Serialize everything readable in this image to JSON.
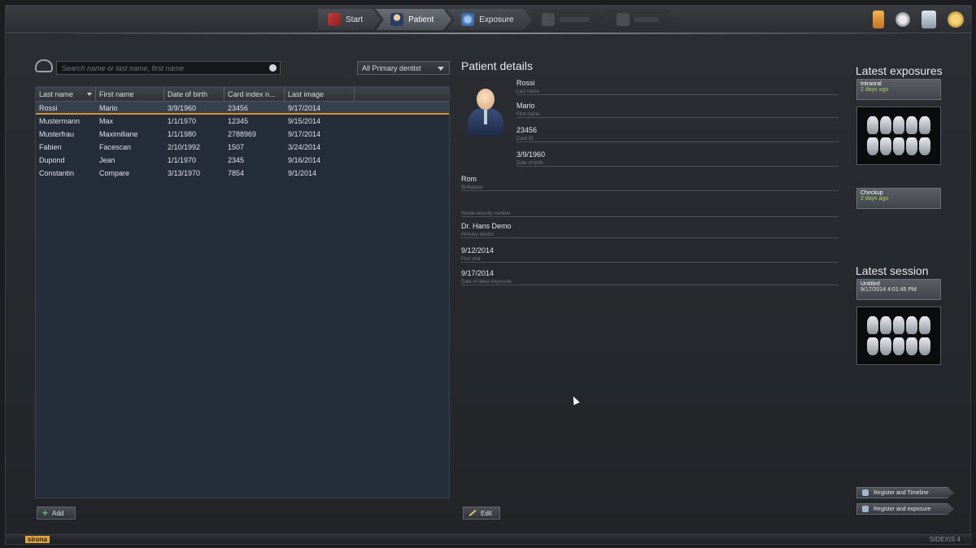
{
  "nav": {
    "steps": [
      {
        "label": "Start",
        "icon": "start-icon",
        "state": "normal"
      },
      {
        "label": "Patient",
        "icon": "patient-icon",
        "state": "active"
      },
      {
        "label": "Exposure",
        "icon": "exposure-icon",
        "state": "normal"
      },
      {
        "label": "",
        "icon": "disabled-step-icon",
        "state": "disabled"
      },
      {
        "label": "",
        "icon": "disabled-step-icon",
        "state": "disabled"
      }
    ],
    "tools": [
      "folder-icon",
      "gear-icon",
      "monitor-icon",
      "help-icon"
    ]
  },
  "search": {
    "placeholder": "Search name or last name, first name",
    "dentist_filter": "All Primary dentist"
  },
  "patient_table": {
    "columns": [
      "Last name",
      "First name",
      "Date of birth",
      "Card index n...",
      "Last image"
    ],
    "rows": [
      [
        "Rossi",
        "Mario",
        "3/9/1960",
        "23456",
        "9/17/2014"
      ],
      [
        "Mustermann",
        "Max",
        "1/1/1970",
        "12345",
        "9/15/2014"
      ],
      [
        "Musterfrau",
        "Maximiliane",
        "1/1/1980",
        "2788969",
        "9/17/2014"
      ],
      [
        "Fabien",
        "Facescan",
        "2/10/1992",
        "1507",
        "3/24/2014"
      ],
      [
        "Dupond",
        "Jean",
        "1/1/1970",
        "2345",
        "9/16/2014"
      ],
      [
        "Constantin",
        "Compare",
        "3/13/1970",
        "7854",
        "9/1/2014"
      ]
    ],
    "selected_row": 0
  },
  "buttons": {
    "add": "Add",
    "edit": "Edit",
    "register_timeline": "Register and Timeline",
    "register_exposure": "Register and exposure"
  },
  "patient_details": {
    "title": "Patient details",
    "fields": [
      {
        "value": "Rossi",
        "label": "Last name"
      },
      {
        "value": "Mario",
        "label": "First name"
      },
      {
        "value": "23456",
        "label": "Card ID"
      },
      {
        "value": "3/9/1960",
        "label": "Date of birth"
      },
      {
        "value": "Rom",
        "label": "Birthplace"
      },
      {
        "value": "",
        "label": "Social security number"
      },
      {
        "value": "Dr. Hans Demo",
        "label": "Primary dentist"
      },
      {
        "value": "9/12/2014",
        "label": "First visit"
      },
      {
        "value": "9/17/2014",
        "label": "Date of latest exposure"
      }
    ]
  },
  "latest_exposures": {
    "title": "Latest exposures",
    "items": [
      {
        "name": "Intraoral",
        "when": "2 days ago"
      },
      {
        "name": "Checkup",
        "when": "2 days ago"
      }
    ]
  },
  "latest_session": {
    "title": "Latest session",
    "name": "Untitled",
    "datetime": "9/17/2014 4:01:45 PM"
  },
  "status": {
    "brand": "sirona",
    "product": "SIDEXIS 4"
  },
  "colors": {
    "accent_orange": "#d98e2a",
    "time_green": "#a9cf5a",
    "table_bg": "#262d3a"
  }
}
